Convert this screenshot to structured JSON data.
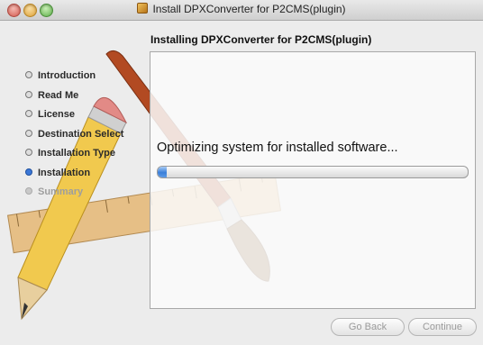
{
  "window": {
    "title": "Install DPXConverter for P2CMS(plugin)"
  },
  "heading": "Installing DPXConverter for P2CMS(plugin)",
  "sidebar": {
    "steps": [
      {
        "label": "Introduction",
        "state": "done"
      },
      {
        "label": "Read Me",
        "state": "done"
      },
      {
        "label": "License",
        "state": "done"
      },
      {
        "label": "Destination Select",
        "state": "done"
      },
      {
        "label": "Installation Type",
        "state": "done"
      },
      {
        "label": "Installation",
        "state": "current"
      },
      {
        "label": "Summary",
        "state": "future"
      }
    ]
  },
  "main": {
    "status_text": "Optimizing system for installed software...",
    "progress": 0.03
  },
  "buttons": {
    "back_label": "Go Back",
    "continue_label": "Continue"
  },
  "icons": {
    "title": "package-icon",
    "traffic_lights": [
      "close-icon",
      "minimize-icon",
      "zoom-icon"
    ]
  },
  "colors": {
    "accent": "#3b7fd9",
    "current_step": "#3b78d8"
  }
}
